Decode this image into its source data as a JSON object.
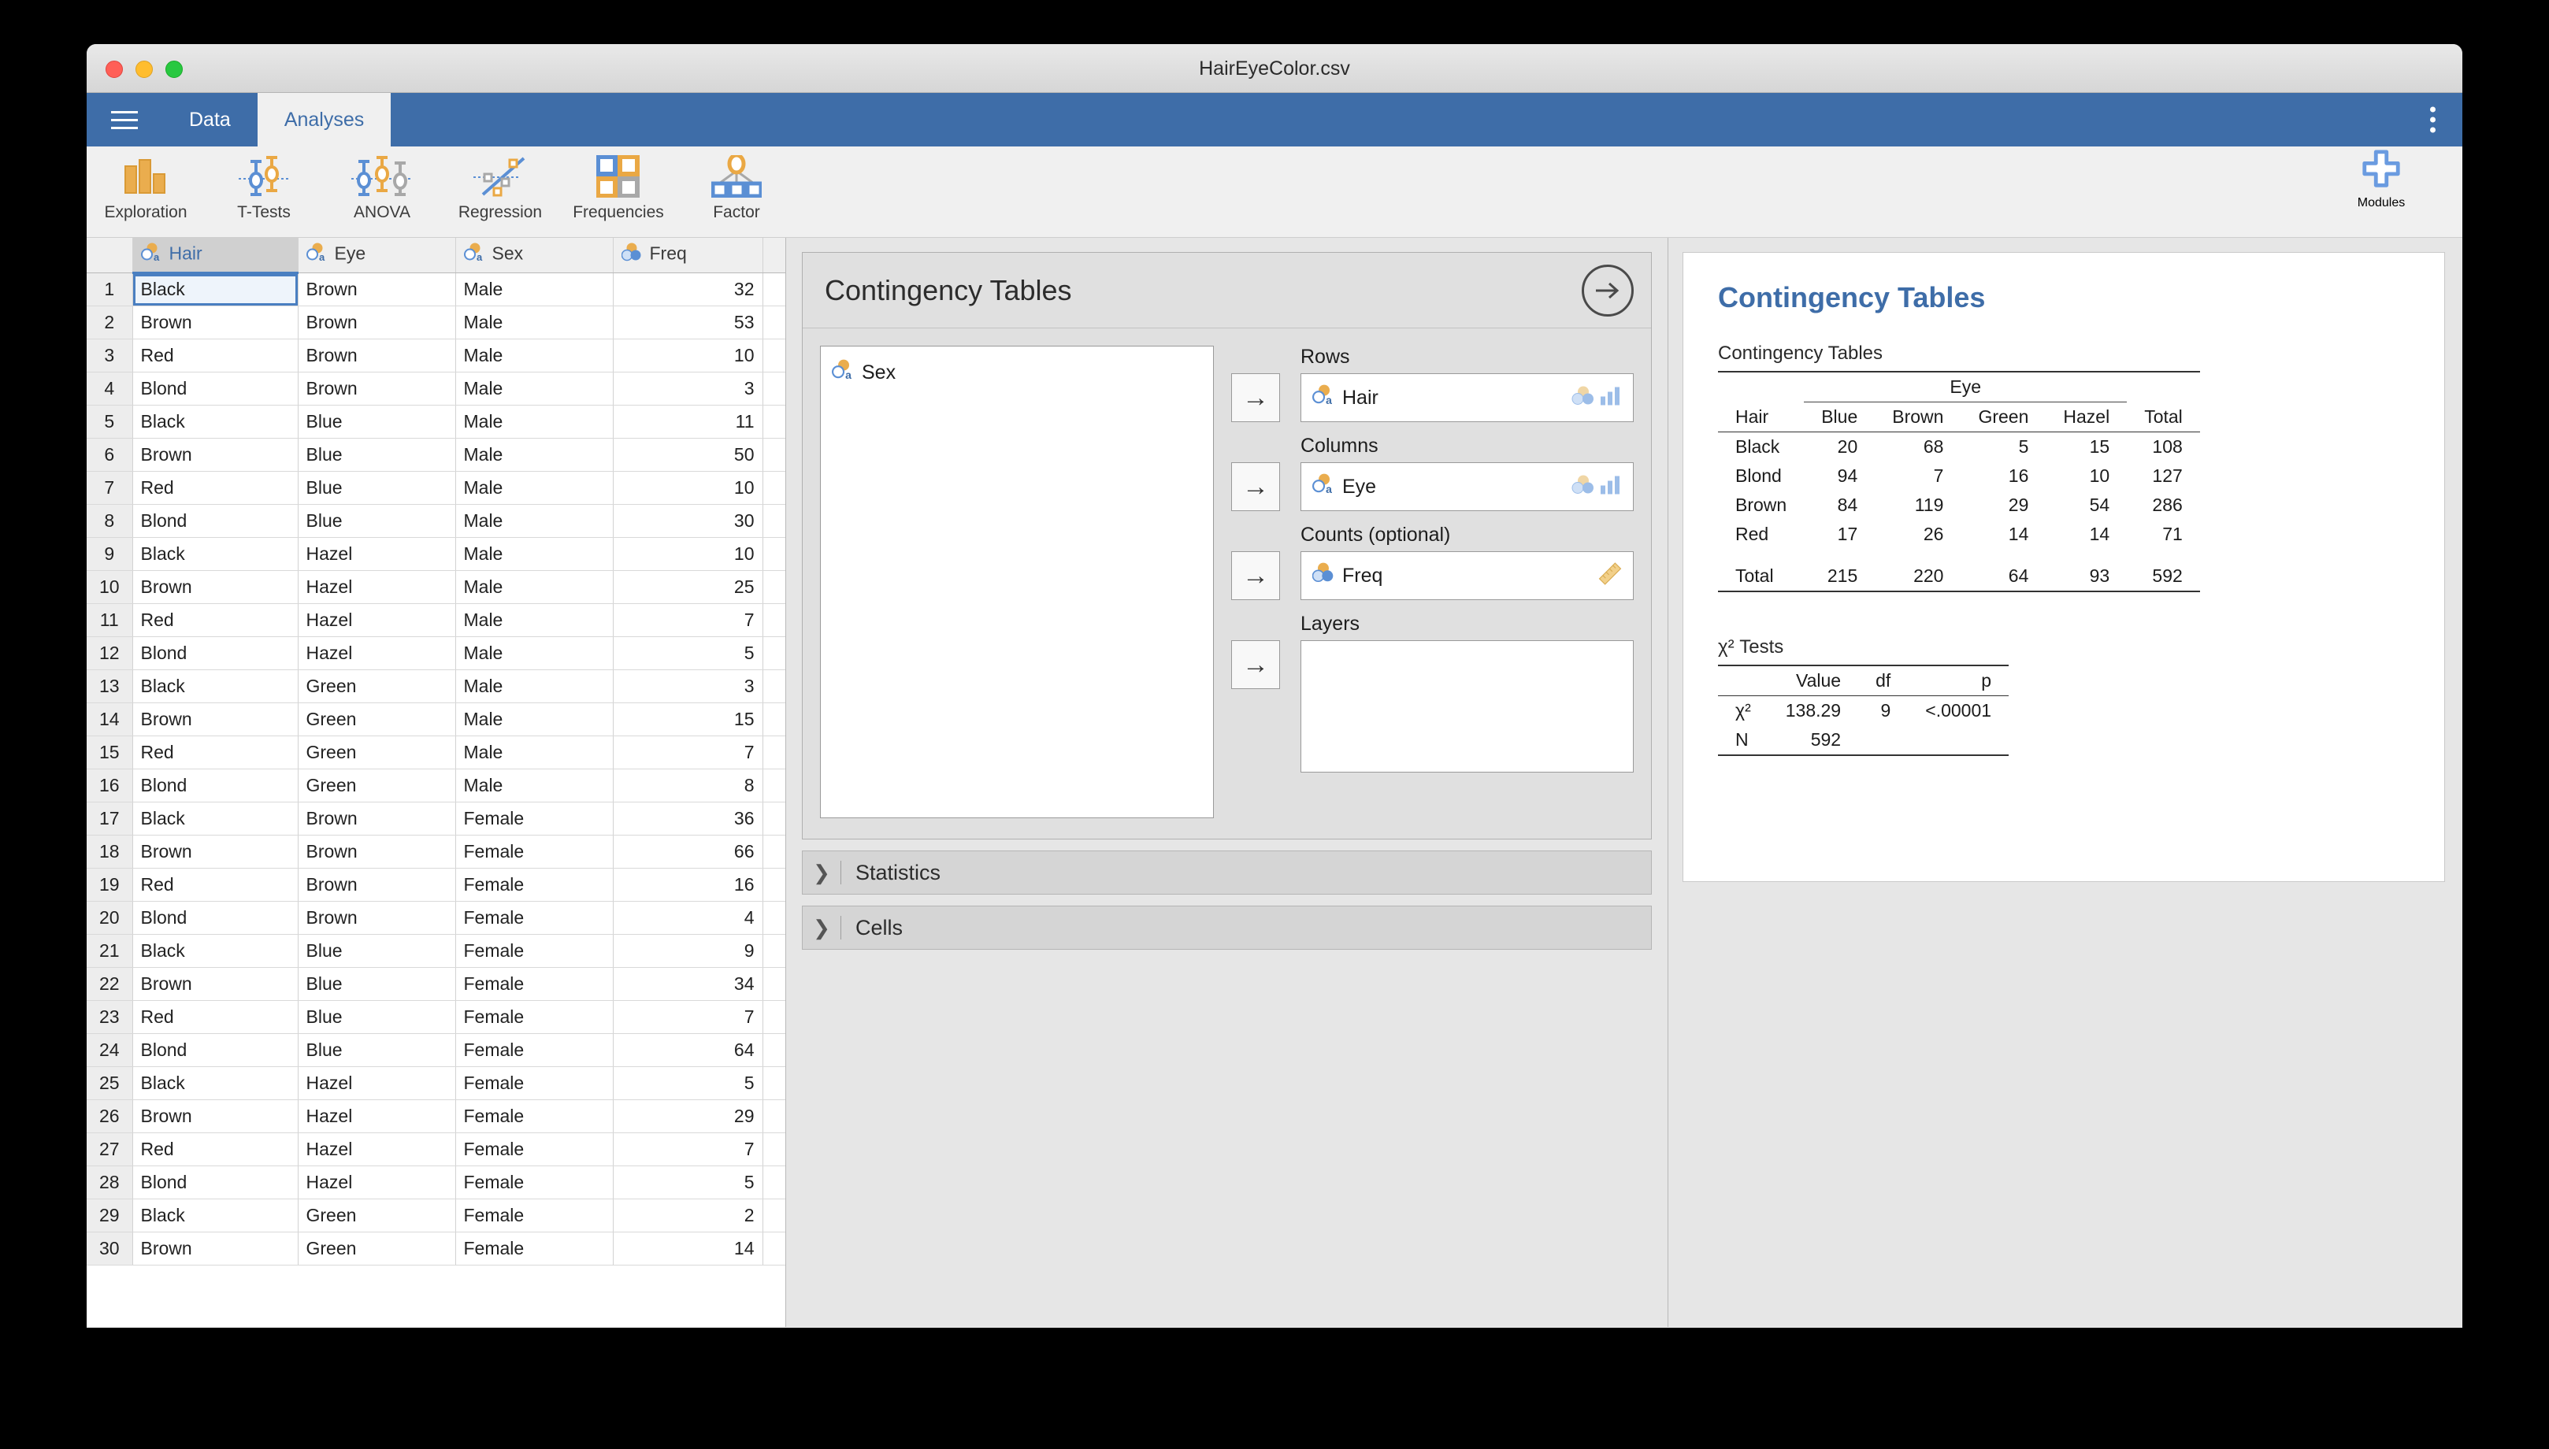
{
  "window": {
    "title": "HairEyeColor.csv",
    "traffic_lights": [
      "close-red",
      "minimize-yellow",
      "maximize-green"
    ]
  },
  "tabbar": {
    "menu_icon": "hamburger-icon",
    "overflow_icon": "kebab-menu-icon",
    "tabs": [
      {
        "label": "Data",
        "active": false
      },
      {
        "label": "Analyses",
        "active": true
      }
    ]
  },
  "ribbon": {
    "buttons": [
      {
        "label": "Exploration",
        "icon": "bar-chart-icon"
      },
      {
        "label": "T-Tests",
        "icon": "two-group-errorbar-icon"
      },
      {
        "label": "ANOVA",
        "icon": "three-group-errorbar-icon"
      },
      {
        "label": "Regression",
        "icon": "scatter-line-icon"
      },
      {
        "label": "Frequencies",
        "icon": "four-squares-icon"
      },
      {
        "label": "Factor",
        "icon": "factor-tree-icon"
      }
    ],
    "modules": {
      "label": "Modules",
      "icon": "plus-icon"
    }
  },
  "spreadsheet": {
    "columns": [
      {
        "name": "Hair",
        "icon": "nominal-text-icon",
        "selected": true
      },
      {
        "name": "Eye",
        "icon": "nominal-text-icon",
        "selected": false
      },
      {
        "name": "Sex",
        "icon": "nominal-text-icon",
        "selected": false
      },
      {
        "name": "Freq",
        "icon": "continuous-icon",
        "selected": false
      }
    ],
    "selected_cell": {
      "row": 1,
      "column": "Hair"
    },
    "rows": [
      {
        "n": "1",
        "Hair": "Black",
        "Eye": "Brown",
        "Sex": "Male",
        "Freq": "32"
      },
      {
        "n": "2",
        "Hair": "Brown",
        "Eye": "Brown",
        "Sex": "Male",
        "Freq": "53"
      },
      {
        "n": "3",
        "Hair": "Red",
        "Eye": "Brown",
        "Sex": "Male",
        "Freq": "10"
      },
      {
        "n": "4",
        "Hair": "Blond",
        "Eye": "Brown",
        "Sex": "Male",
        "Freq": "3"
      },
      {
        "n": "5",
        "Hair": "Black",
        "Eye": "Blue",
        "Sex": "Male",
        "Freq": "11"
      },
      {
        "n": "6",
        "Hair": "Brown",
        "Eye": "Blue",
        "Sex": "Male",
        "Freq": "50"
      },
      {
        "n": "7",
        "Hair": "Red",
        "Eye": "Blue",
        "Sex": "Male",
        "Freq": "10"
      },
      {
        "n": "8",
        "Hair": "Blond",
        "Eye": "Blue",
        "Sex": "Male",
        "Freq": "30"
      },
      {
        "n": "9",
        "Hair": "Black",
        "Eye": "Hazel",
        "Sex": "Male",
        "Freq": "10"
      },
      {
        "n": "10",
        "Hair": "Brown",
        "Eye": "Hazel",
        "Sex": "Male",
        "Freq": "25"
      },
      {
        "n": "11",
        "Hair": "Red",
        "Eye": "Hazel",
        "Sex": "Male",
        "Freq": "7"
      },
      {
        "n": "12",
        "Hair": "Blond",
        "Eye": "Hazel",
        "Sex": "Male",
        "Freq": "5"
      },
      {
        "n": "13",
        "Hair": "Black",
        "Eye": "Green",
        "Sex": "Male",
        "Freq": "3"
      },
      {
        "n": "14",
        "Hair": "Brown",
        "Eye": "Green",
        "Sex": "Male",
        "Freq": "15"
      },
      {
        "n": "15",
        "Hair": "Red",
        "Eye": "Green",
        "Sex": "Male",
        "Freq": "7"
      },
      {
        "n": "16",
        "Hair": "Blond",
        "Eye": "Green",
        "Sex": "Male",
        "Freq": "8"
      },
      {
        "n": "17",
        "Hair": "Black",
        "Eye": "Brown",
        "Sex": "Female",
        "Freq": "36"
      },
      {
        "n": "18",
        "Hair": "Brown",
        "Eye": "Brown",
        "Sex": "Female",
        "Freq": "66"
      },
      {
        "n": "19",
        "Hair": "Red",
        "Eye": "Brown",
        "Sex": "Female",
        "Freq": "16"
      },
      {
        "n": "20",
        "Hair": "Blond",
        "Eye": "Brown",
        "Sex": "Female",
        "Freq": "4"
      },
      {
        "n": "21",
        "Hair": "Black",
        "Eye": "Blue",
        "Sex": "Female",
        "Freq": "9"
      },
      {
        "n": "22",
        "Hair": "Brown",
        "Eye": "Blue",
        "Sex": "Female",
        "Freq": "34"
      },
      {
        "n": "23",
        "Hair": "Red",
        "Eye": "Blue",
        "Sex": "Female",
        "Freq": "7"
      },
      {
        "n": "24",
        "Hair": "Blond",
        "Eye": "Blue",
        "Sex": "Female",
        "Freq": "64"
      },
      {
        "n": "25",
        "Hair": "Black",
        "Eye": "Hazel",
        "Sex": "Female",
        "Freq": "5"
      },
      {
        "n": "26",
        "Hair": "Brown",
        "Eye": "Hazel",
        "Sex": "Female",
        "Freq": "29"
      },
      {
        "n": "27",
        "Hair": "Red",
        "Eye": "Hazel",
        "Sex": "Female",
        "Freq": "7"
      },
      {
        "n": "28",
        "Hair": "Blond",
        "Eye": "Hazel",
        "Sex": "Female",
        "Freq": "5"
      },
      {
        "n": "29",
        "Hair": "Black",
        "Eye": "Green",
        "Sex": "Female",
        "Freq": "2"
      },
      {
        "n": "30",
        "Hair": "Brown",
        "Eye": "Green",
        "Sex": "Female",
        "Freq": "14"
      }
    ]
  },
  "options": {
    "title": "Contingency Tables",
    "next_icon": "arrow-right-circle-icon",
    "available_variables": [
      {
        "name": "Sex",
        "icon": "nominal-text-icon"
      }
    ],
    "assignments": [
      {
        "label": "Rows",
        "arrow_icon": "arrow-right-icon",
        "items": [
          {
            "name": "Hair",
            "icon": "nominal-text-icon"
          }
        ],
        "permitted_icons": [
          "nominal-icon",
          "ordinal-bars-icon"
        ]
      },
      {
        "label": "Columns",
        "arrow_icon": "arrow-right-icon",
        "items": [
          {
            "name": "Eye",
            "icon": "nominal-text-icon"
          }
        ],
        "permitted_icons": [
          "nominal-icon",
          "ordinal-bars-icon"
        ]
      },
      {
        "label": "Counts (optional)",
        "arrow_icon": "arrow-right-icon",
        "items": [
          {
            "name": "Freq",
            "icon": "continuous-icon"
          }
        ],
        "permitted_icons": [
          "ruler-icon"
        ]
      },
      {
        "label": "Layers",
        "arrow_icon": "arrow-right-icon",
        "items": [],
        "permitted_icons": []
      }
    ],
    "collapsers": [
      {
        "label": "Statistics",
        "icon": "chevron-right-icon",
        "expanded": false
      },
      {
        "label": "Cells",
        "icon": "chevron-right-icon",
        "expanded": false
      }
    ]
  },
  "results": {
    "heading": "Contingency Tables",
    "chart_data": [
      {
        "type": "table",
        "title": "Contingency Tables",
        "column_group_label": "Eye",
        "row_label": "Hair",
        "categories": [
          "Blue",
          "Brown",
          "Green",
          "Hazel"
        ],
        "total_label": "Total",
        "rows": [
          {
            "label": "Black",
            "values": [
              20,
              68,
              5,
              15
            ],
            "total": 108
          },
          {
            "label": "Blond",
            "values": [
              94,
              7,
              16,
              10
            ],
            "total": 127
          },
          {
            "label": "Brown",
            "values": [
              84,
              119,
              29,
              54
            ],
            "total": 286
          },
          {
            "label": "Red",
            "values": [
              17,
              26,
              14,
              14
            ],
            "total": 71
          }
        ],
        "column_totals": [
          215,
          220,
          64,
          93
        ],
        "grand_total": 592
      },
      {
        "type": "table",
        "title": "χ² Tests",
        "headers": [
          "",
          "Value",
          "df",
          "p"
        ],
        "rows": [
          {
            "label": "χ²",
            "value": "138.29",
            "df": "9",
            "p": "<.00001"
          },
          {
            "label": "N",
            "value": "592",
            "df": "",
            "p": ""
          }
        ]
      }
    ]
  },
  "colors": {
    "accent_blue": "#3e6da8",
    "ribbon_bg": "#f0f0f0",
    "panel_bg": "#e6e6e6",
    "icon_orange": "#eaa844",
    "icon_blue": "#5b8fd4"
  }
}
